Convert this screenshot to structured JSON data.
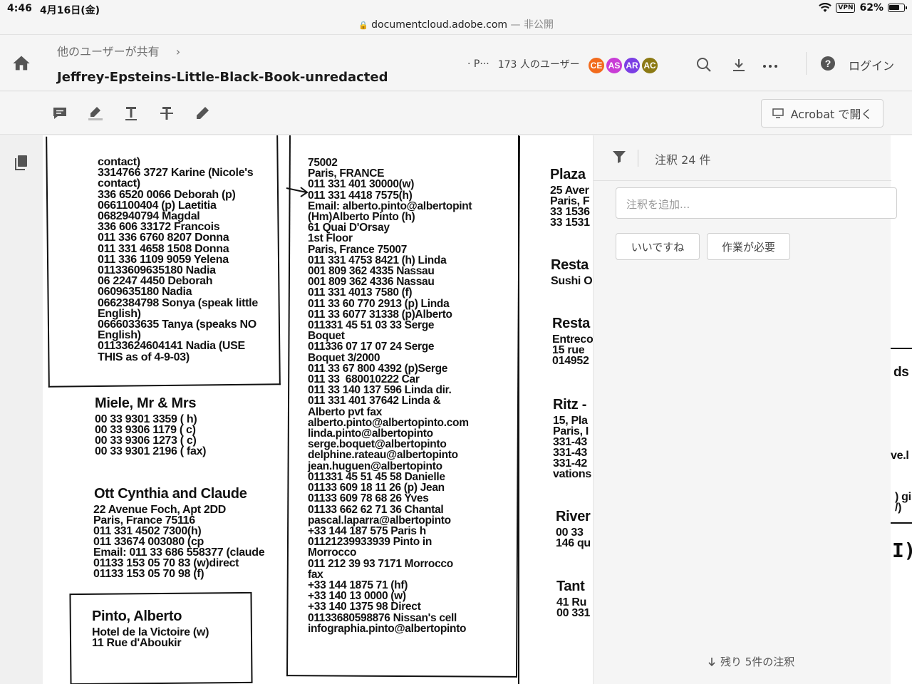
{
  "status_bar": {
    "time": "4:46",
    "date": "4月16日(金)",
    "url": "documentcloud.adobe.com",
    "privacy": "— 非公開",
    "vpn": "VPN",
    "battery": "62%"
  },
  "header": {
    "breadcrumb": "他のユーザーが共有",
    "title": "Jeffrey-Epsteins-Little-Black-Book-unredacted",
    "share_prefix": "· P···",
    "users_label": "173 人のユーザー",
    "avatars": [
      {
        "initials": "CE",
        "color": "#f26b1d"
      },
      {
        "initials": "AS",
        "color": "#c93cd6"
      },
      {
        "initials": "AR",
        "color": "#7b3fe4"
      },
      {
        "initials": "AC",
        "color": "#8c7a14"
      }
    ],
    "login": "ログイン"
  },
  "toolbar": {
    "open_in_acrobat": "Acrobat で開く"
  },
  "comments_panel": {
    "count_label": "注釈 24 件",
    "input_placeholder": "注釈を追加...",
    "chip_like": "いいですね",
    "chip_action": "作業が必要",
    "remaining": "残り 5件の注釈"
  },
  "document": {
    "col1_top": "contact)\n3314766 3727 Karine (Nicole's\ncontact)\n336 6520 0066 Deborah (p)\n0661100404 (p) Laetitia\n0682940794 Magdal\n336 606 33172 Francois\n011 336 6760 8207 Donna\n011 331 4658 1508 Donna\n011 336 1109 9059 Yelena\n01133609635180 Nadia\n06 2247 4450 Deborah\n0609635180 Nadia\n0662384798 Sonya (speak little\nEnglish)\n0666033635 Tanya (speaks NO\nEnglish)\n01133624604141 Nadia (USE\nTHIS as of 4-9-03)",
    "miele_name": "Miele, Mr & Mrs",
    "miele_lines": "00 33 9301 3359 ( h)\n00 33 9306 1179 ( c)\n00 33 9306 1273 ( c)\n00 33 9301 2196 ( fax)",
    "ott_name": "Ott Cynthia and Claude",
    "ott_lines": "22 Avenue Foch, Apt 2DD\nParis, France 75116\n011 331 4502 7300(h)\n011 33674 003080 (cp\nEmail: 011 33 686 558377 (claude\n01133 153 05 70 83 (w)direct\n01133 153 05 70 98 (f)",
    "pinto_name": "Pinto, Alberto",
    "pinto_lines": "Hotel de la Victoire (w)\n11 Rue d'Aboukir",
    "col2": "75002\nParis, FRANCE\n011 331 401 30000(w)\n011 331 4418 7575(h)\nEmail: alberto.pinto@albertopint\n(Hm)Alberto Pinto (h)\n61 Quai D'Orsay\n1st Floor\nParis, France 75007\n011 331 4753 8421 (h) Linda\n001 809 362 4335 Nassau\n001 809 362 4336 Nassau\n011 331 4013 7580 (f)\n011 33 60 770 2913 (p) Linda\n011 33 6077 31338 (p)Alberto\n011331 45 51 03 33 Serge\nBoquet\n011336 07 17 07 24 Serge\nBoquet 3/2000\n011 33 67 800 4392 (p)Serge\n011 33  680010222 Car\n011 33 140 137 596 Linda dir.\n011 331 401 37642 Linda &\nAlberto pvt fax\nalberto.pinto@albertopinto.com\nlinda.pinto@albertopinto\nserge.boquet@albertopinto\ndelphine.rateau@albertopinto\njean.huguen@albertopinto\n011331 45 51 45 58 Danielle\n01133 609 18 11 26 (p) Jean\n01133 609 78 68 26 Yves\n01133 662 62 71 36 Chantal\npascal.laparra@albertopinto\n+33 144 187 575 Paris h\n01121239933939 Pinto in\nMorrocco\n011 212 39 93 7171 Morrocco\nfax\n+33 144 1875 71 (hf)\n+33 140 13 0000 (w)\n+33 140 1375 98 Direct\n01133680598876 Nissan's cell\ninfographia.pinto@albertopinto",
    "col3": [
      {
        "head": "Plaza",
        "lines": "25 Aver\nParis, F\n33 1536\n33 1531"
      },
      {
        "head": "Resta",
        "lines": "Sushi O"
      },
      {
        "head": "Resta",
        "lines": "Entreco\n15 rue\n014952"
      },
      {
        "head": "Ritz -",
        "lines": "15, Pla\nParis, I\n331-43\n331-43\n331-42\nvations"
      },
      {
        "head": "River",
        "lines": "00 33\n146 qu"
      },
      {
        "head": "Tant",
        "lines": "41 Ru\n00 331"
      }
    ],
    "peek": {
      "a": "ds",
      "b": "ve.l",
      "c": ") gi\n/)",
      "d": "I)"
    }
  }
}
